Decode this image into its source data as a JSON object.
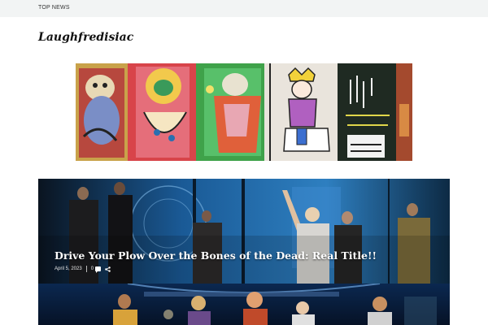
{
  "topbar": {
    "link_label": "TOP NEWS"
  },
  "site": {
    "title": "Laughfredisiac"
  },
  "banner": {
    "icon": "graffiti-mural-image"
  },
  "featured": {
    "title": "Drive Your Plow Over the Bones of the Dead: Real Title!!",
    "date": "April 5, 2023",
    "comments": "0",
    "comment_icon": "comment-icon",
    "share_icon": "share-icon"
  },
  "second_post": {
    "icon": "stage-photo-image"
  }
}
